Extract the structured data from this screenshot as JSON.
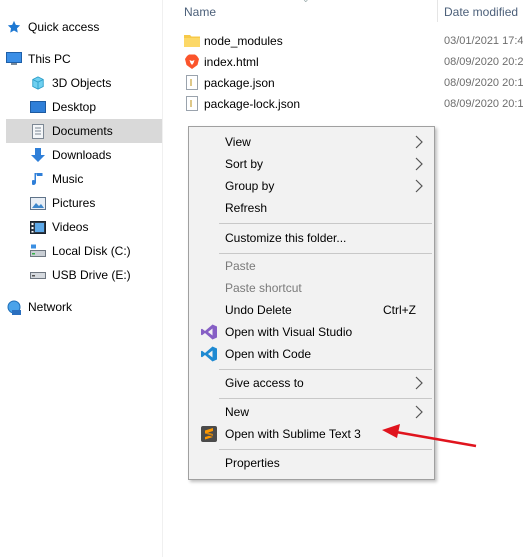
{
  "header": {
    "name_label": "Name",
    "date_label": "Date modified"
  },
  "sidebar": {
    "items": [
      {
        "label": "Quick access",
        "icon": "star-icon"
      },
      {
        "label": "This PC",
        "icon": "computer-icon"
      },
      {
        "label": "3D Objects",
        "icon": "cube-icon"
      },
      {
        "label": "Desktop",
        "icon": "desktop-icon"
      },
      {
        "label": "Documents",
        "icon": "document-icon",
        "selected": true
      },
      {
        "label": "Downloads",
        "icon": "download-icon"
      },
      {
        "label": "Music",
        "icon": "music-note-icon"
      },
      {
        "label": "Pictures",
        "icon": "picture-icon"
      },
      {
        "label": "Videos",
        "icon": "video-icon"
      },
      {
        "label": "Local Disk (C:)",
        "icon": "drive-icon"
      },
      {
        "label": "USB Drive (E:)",
        "icon": "usb-drive-icon"
      },
      {
        "label": "Network",
        "icon": "network-icon"
      }
    ]
  },
  "files": [
    {
      "name": "node_modules",
      "date": "03/01/2021 17:4",
      "icon": "folder-icon"
    },
    {
      "name": "index.html",
      "date": "08/09/2020 20:2",
      "icon": "brave-browser-icon"
    },
    {
      "name": "package.json",
      "date": "08/09/2020 20:1",
      "icon": "json-file-icon"
    },
    {
      "name": "package-lock.json",
      "date": "08/09/2020 20:1",
      "icon": "json-file-icon"
    }
  ],
  "context_menu": {
    "items": [
      {
        "label": "View",
        "submenu": true
      },
      {
        "label": "Sort by",
        "submenu": true
      },
      {
        "label": "Group by",
        "submenu": true
      },
      {
        "label": "Refresh"
      },
      {
        "label": "Customize this folder..."
      },
      {
        "label": "Paste",
        "disabled": true
      },
      {
        "label": "Paste shortcut",
        "disabled": true
      },
      {
        "label": "Undo Delete",
        "shortcut": "Ctrl+Z"
      },
      {
        "label": "Open with Visual Studio",
        "icon": "visual-studio-icon"
      },
      {
        "label": "Open with Code",
        "icon": "vscode-icon"
      },
      {
        "label": "Give access to",
        "submenu": true
      },
      {
        "label": "New",
        "submenu": true
      },
      {
        "label": "Open with Sublime Text 3",
        "icon": "sublime-text-icon"
      },
      {
        "label": "Properties"
      }
    ]
  },
  "colors": {
    "selected_bg": "#d9d9d9",
    "menu_bg": "#f2f2f2",
    "annotation_arrow": "#e0141e",
    "header_text": "#4c607a"
  }
}
